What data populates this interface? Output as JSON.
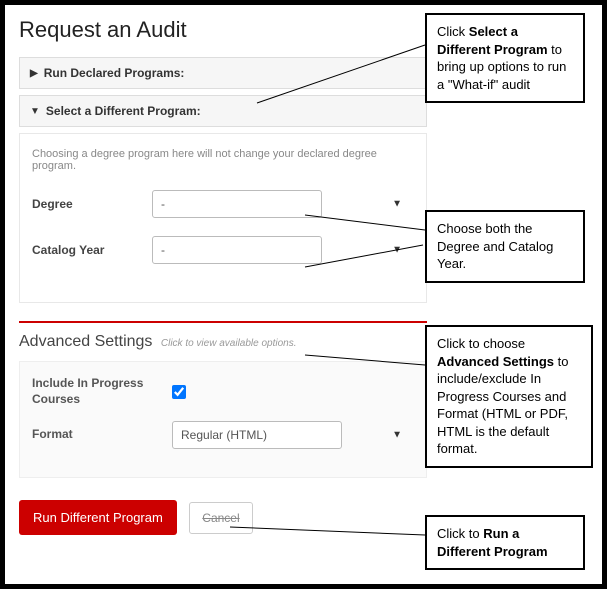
{
  "page": {
    "title": "Request an Audit"
  },
  "accordions": {
    "declared": {
      "label": "Run Declared Programs:"
    },
    "different": {
      "label": "Select a Different Program:"
    }
  },
  "different_panel": {
    "hint": "Choosing a degree program here will not change your declared degree program.",
    "degree_label": "Degree",
    "degree_value": "-",
    "catalog_label": "Catalog Year",
    "catalog_value": "-"
  },
  "advanced": {
    "title": "Advanced Settings",
    "subtitle": "Click to view available options.",
    "include_label": "Include In Progress Courses",
    "include_checked": true,
    "format_label": "Format",
    "format_value": "Regular (HTML)"
  },
  "buttons": {
    "run": "Run Different Program",
    "cancel": "Cancel"
  },
  "callouts": {
    "c1": {
      "pre": "Click ",
      "bold": "Select a Different Program",
      "post": " to bring up options to run a \"What-if\" audit"
    },
    "c2": {
      "text": "Choose both the Degree and Catalog Year."
    },
    "c3": {
      "pre": "Click to choose ",
      "bold": "Advanced Settings",
      "post": " to include/exclude In Progress Courses and Format (HTML or PDF, HTML is the default format."
    },
    "c4": {
      "pre": "Click to ",
      "bold": "Run a Different Program",
      "post": ""
    }
  }
}
